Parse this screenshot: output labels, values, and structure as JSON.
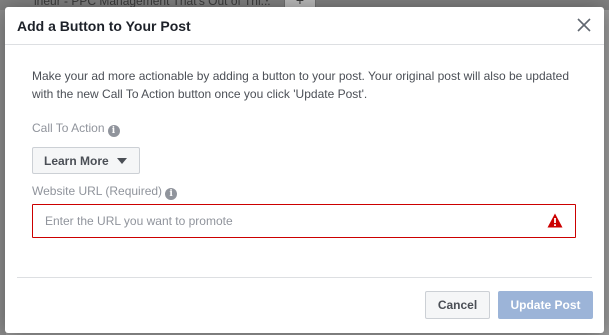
{
  "background": {
    "topbar_text": "ineur - PPC Management That's Out of Thi...",
    "topbar_button_label": "+"
  },
  "modal": {
    "title": "Add a Button to Your Post",
    "description": "Make your ad more actionable by adding a button to your post. Your original post will also be updated with the new Call To Action button once you click 'Update Post'.",
    "call_to_action": {
      "label": "Call To Action",
      "selected": "Learn More"
    },
    "website_url": {
      "label": "Website URL (Required)",
      "value": "",
      "placeholder": "Enter the URL you want to promote"
    },
    "buttons": {
      "cancel": "Cancel",
      "update": "Update Post"
    }
  },
  "colors": {
    "error_border": "#cc0000",
    "update_button_disabled": "#9cb4d8",
    "label_gray": "#90949c",
    "warning_icon": "#cc0000"
  },
  "icons": {
    "close": "close-icon",
    "info": "info-icon",
    "caret": "caret-down-icon",
    "warning": "warning-icon"
  }
}
